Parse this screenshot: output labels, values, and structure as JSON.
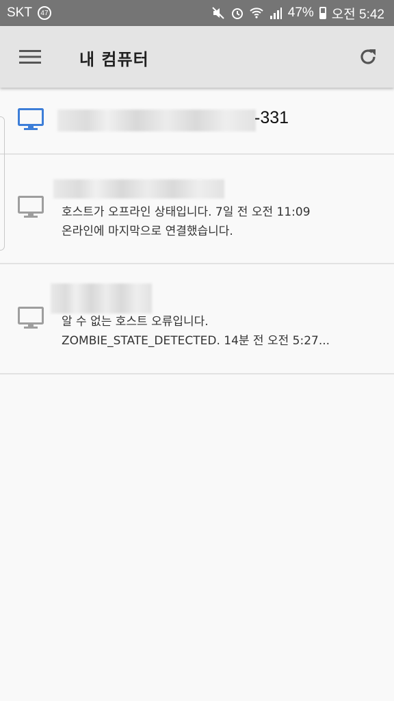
{
  "status_bar": {
    "carrier": "SKT",
    "badge": "47",
    "battery": "47%",
    "time": "오전 5:42"
  },
  "app_bar": {
    "title": "내 컴퓨터",
    "menu_icon": "hamburger-menu-icon",
    "refresh_icon": "refresh-icon"
  },
  "computers": [
    {
      "name_suffix": "-331",
      "online": true,
      "icon_color": "#3d7ed8"
    },
    {
      "status_line1": "호스트가 오프라인 상태입니다. 7일 전 오전 11:09",
      "status_line2": "온라인에 마지막으로 연결했습니다.",
      "online": false,
      "icon_color": "#9e9e9e"
    },
    {
      "status_line1": "알 수 없는 호스트 오류입니다.",
      "status_line2": "ZOMBIE_STATE_DETECTED. 14분 전 오전 5:27...",
      "online": false,
      "icon_color": "#9e9e9e"
    }
  ]
}
